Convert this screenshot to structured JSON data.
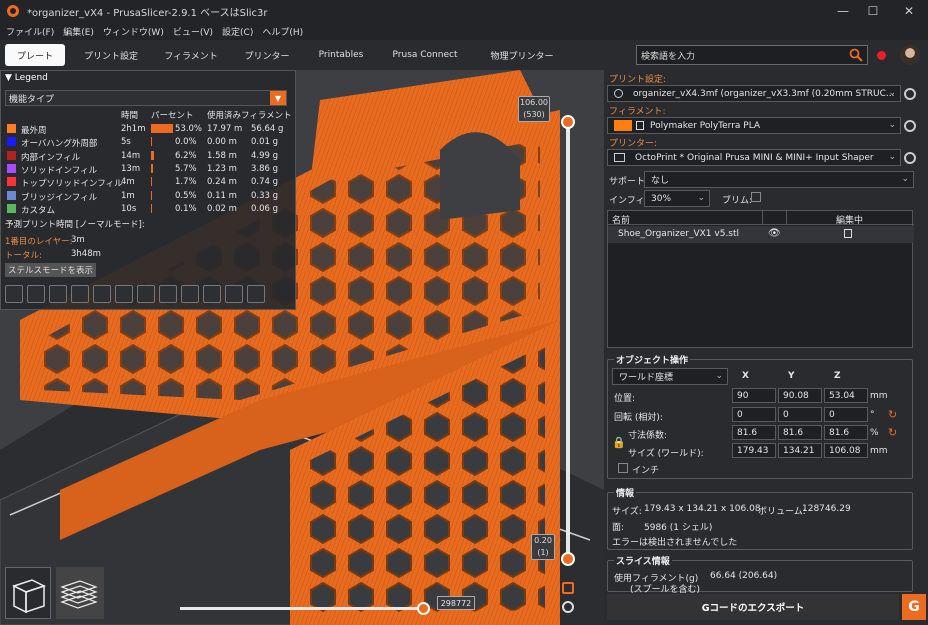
{
  "window": {
    "title": "*organizer_vX4 - PrusaSlicer-2.9.1 ベースはSlic3r"
  },
  "menu": [
    "ファイル(F)",
    "編集(E)",
    "ウィンドウ(W)",
    "ビュー(V)",
    "設定(C)",
    "ヘルプ(H)"
  ],
  "tabs": [
    "プレート",
    "プリント設定",
    "フィラメント",
    "プリンター",
    "Printables",
    "Prusa Connect",
    "物理プリンター"
  ],
  "search": {
    "placeholder": "検索語を入力"
  },
  "legend": {
    "title": "Legend",
    "mode": "機能タイプ",
    "columns": {
      "time": "時間",
      "percent": "パーセント",
      "used": "使用済みフィラメント"
    },
    "rows": [
      {
        "name": "最外周",
        "time": "2h1m",
        "percent": "53.0%",
        "pct": 53.0,
        "m": "17.97 m",
        "g": "56.64 g",
        "color": "#ff7f27"
      },
      {
        "name": "オーバハング外周部",
        "time": "5s",
        "percent": "0.0%",
        "pct": 0.0,
        "m": "0.00 m",
        "g": "0.01 g",
        "color": "#1a1aff"
      },
      {
        "name": "内部インフィル",
        "time": "14m",
        "percent": "6.2%",
        "pct": 6.2,
        "m": "1.58 m",
        "g": "4.99 g",
        "color": "#b22222"
      },
      {
        "name": "ソリッドインフィル",
        "time": "13m",
        "percent": "5.7%",
        "pct": 5.7,
        "m": "1.23 m",
        "g": "3.86 g",
        "color": "#a64dff"
      },
      {
        "name": "トップソリッドインフィル",
        "time": "4m",
        "percent": "1.7%",
        "pct": 1.7,
        "m": "0.24 m",
        "g": "0.74 g",
        "color": "#ff3333"
      },
      {
        "name": "ブリッジインフィル",
        "time": "1m",
        "percent": "0.5%",
        "pct": 0.5,
        "m": "0.11 m",
        "g": "0.33 g",
        "color": "#6b8bd1"
      },
      {
        "name": "カスタム",
        "time": "10s",
        "percent": "0.1%",
        "pct": 0.1,
        "m": "0.02 m",
        "g": "0.06 g",
        "color": "#5cb85c"
      }
    ],
    "estimate_title": "予測プリント時間 [ノーマルモード]:",
    "first_layer_label": "1番目のレイヤー:",
    "first_layer_value": "3m",
    "total_label": "トータル:",
    "total_value": "3h48m",
    "stealth_button": "ステルスモードを表示"
  },
  "slider": {
    "top_value": "106.00",
    "top_layer": "(530)",
    "bottom_value": "0.20",
    "bottom_layer": "(1)",
    "h_value": "298772"
  },
  "panel": {
    "print_label": "プリント設定:",
    "print_value": "organizer_vX4.3mf (organizer_vX3.3mf (0.20mm STRUC...",
    "filament_label": "フィラメント:",
    "filament_value": "Polymaker PolyTerra PLA",
    "filament_color": "#ff7f0e",
    "printer_label": "プリンター:",
    "printer_value": "OctoPrint * Original Prusa MINI & MINI+ Input Shaper",
    "support_label": "サポート:",
    "support_value": "なし",
    "infill_label": "インフィル:",
    "infill_value": "30%",
    "brim_label": "ブリム:",
    "list_name_header": "名前",
    "list_edit_header": "編集中",
    "object_name": "Shoe_Organizer_VX1 v5.stl",
    "obj_ops_title": "オブジェクト操作",
    "coord_mode": "ワールド座標",
    "axis_x": "X",
    "axis_y": "Y",
    "axis_z": "Z",
    "pos_label": "位置:",
    "pos": [
      "90",
      "90.08",
      "53.04"
    ],
    "unit_mm": "mm",
    "rot_label": "回転 (相対):",
    "rot": [
      "0",
      "0",
      "0"
    ],
    "unit_deg": "°",
    "scale_label": "寸法係数:",
    "scale": [
      "81.6",
      "81.6",
      "81.6"
    ],
    "unit_pct": "%",
    "size_label": "サイズ (ワールド):",
    "size": [
      "179.43",
      "134.21",
      "106.08"
    ],
    "inch_label": "インチ",
    "info_title": "情報",
    "info_size_label": "サイズ:",
    "info_size": "179.43 x 134.21 x 106.08",
    "info_vol_label": "ボリューム:",
    "info_vol": "128746.29",
    "info_faces_label": "面:",
    "info_faces": "5986 (1 シェル)",
    "info_errors": "エラーは検出されませんでした",
    "slice_title": "スライス情報",
    "slice_filament_label": "使用フィラメント(g)",
    "slice_spool_label": "(スプールを含む)",
    "slice_filament_value": "66.64 (206.64)",
    "export_button": "Gコードのエクスポート"
  }
}
